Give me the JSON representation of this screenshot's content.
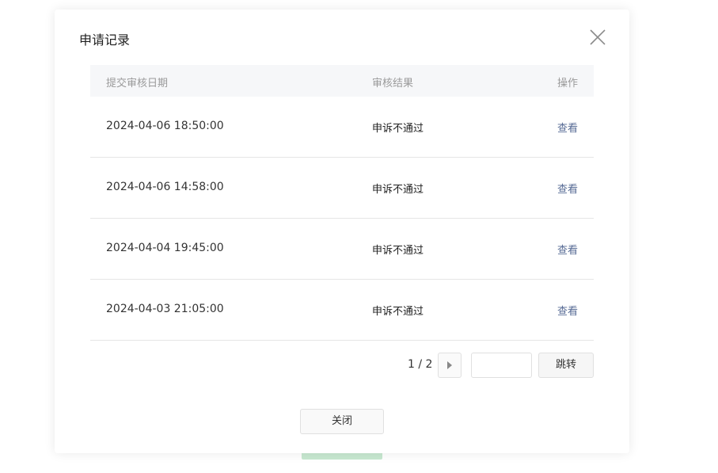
{
  "dialog": {
    "title": "申请记录",
    "close_icon": "close-icon"
  },
  "table": {
    "headers": {
      "date": "提交审核日期",
      "result": "审核结果",
      "action": "操作"
    },
    "rows": [
      {
        "date": "2024-04-06 18:50:00",
        "result": "申诉不通过",
        "action": "查看"
      },
      {
        "date": "2024-04-06 14:58:00",
        "result": "申诉不通过",
        "action": "查看"
      },
      {
        "date": "2024-04-04 19:45:00",
        "result": "申诉不通过",
        "action": "查看"
      },
      {
        "date": "2024-04-03 21:05:00",
        "result": "申诉不通过",
        "action": "查看"
      }
    ]
  },
  "pagination": {
    "page_text": "1 / 2",
    "next_icon": "triangle-right-icon",
    "jump_input_value": "",
    "jump_label": "跳转"
  },
  "footer": {
    "close_label": "关闭"
  },
  "colors": {
    "link": "#576b95",
    "header_bg": "#f6f7f9",
    "background_button": "#c7e8d0"
  }
}
